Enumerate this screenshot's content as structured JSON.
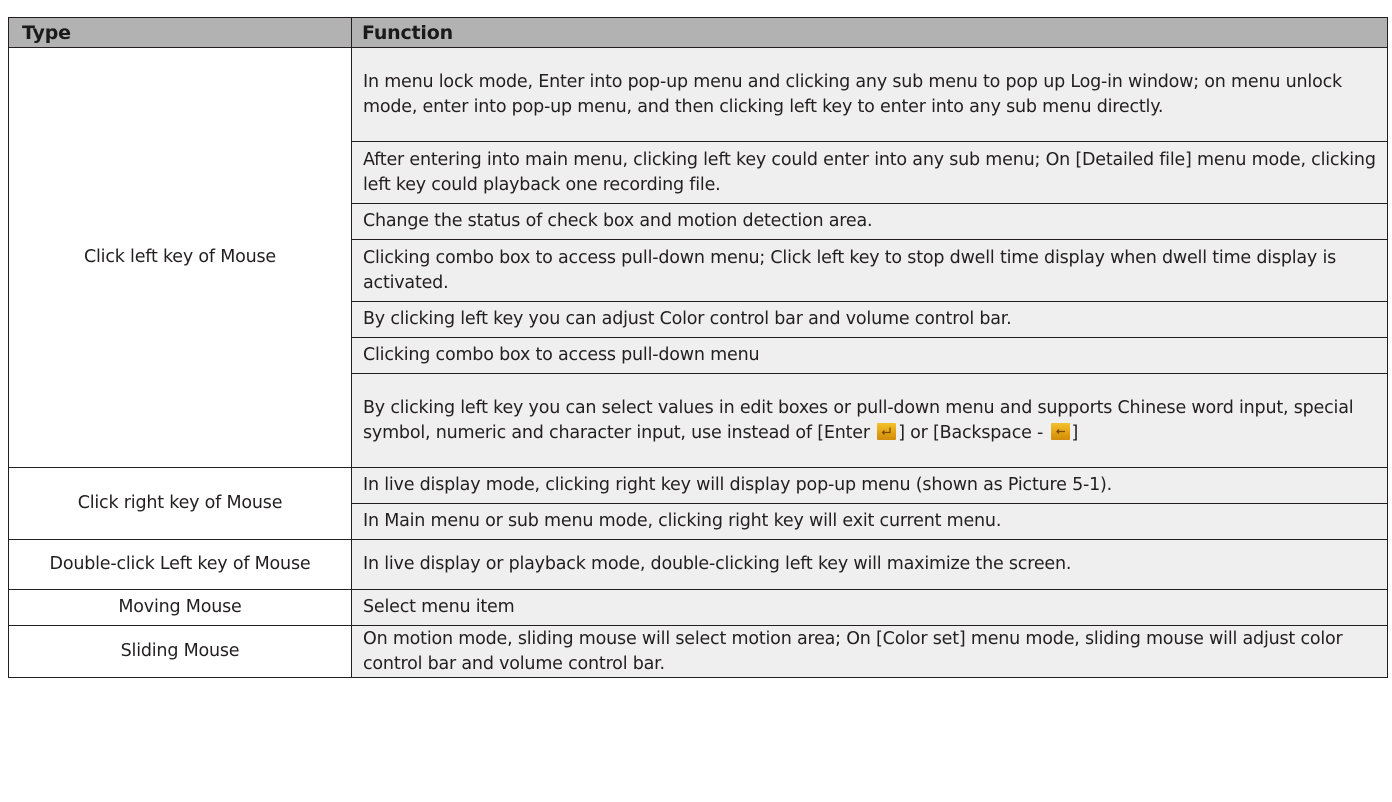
{
  "table": {
    "headers": {
      "type": "Type",
      "function": "Function"
    },
    "rows": [
      {
        "type": "Click left key of Mouse",
        "functions": [
          "In menu lock mode, Enter into pop-up menu and clicking any sub menu to pop up Log-in window; on menu unlock mode,  enter into pop-up menu, and then clicking left key to enter into any sub menu directly.",
          "After entering into main menu, clicking left key could enter into any sub menu; On [Detailed file] menu mode, clicking left key could playback one recording file.",
          "Change the status of check box and motion detection area.",
          "Clicking combo box to access pull-down menu; Click left key to stop dwell time display when dwell time display is activated.",
          "By clicking left key you can adjust Color control bar and volume control bar.",
          "Clicking combo box to access pull-down menu"
        ],
        "last_function": {
          "text_a": "By clicking left key you can select values in edit boxes or pull-down menu and supports Chinese word input, special symbol, numeric and character input, use instead of [Enter ",
          "text_b": "] or [Backspace - ",
          "text_c": "]",
          "enter_icon": "enter-key-icon",
          "backspace_icon": "backspace-key-icon"
        }
      },
      {
        "type": "Click right key of Mouse",
        "functions": [
          "In live display mode, clicking right key will display pop-up menu (shown as Picture 5-1).",
          "In Main menu or sub menu mode, clicking right key will exit current menu."
        ]
      },
      {
        "type": "Double-click Left key of Mouse",
        "functions": [
          "In live display or playback mode, double-clicking left key will maximize the screen."
        ]
      },
      {
        "type": "Moving Mouse",
        "functions": [
          "Select menu item"
        ]
      },
      {
        "type": "Sliding Mouse",
        "functions": [
          "On motion mode, sliding mouse will select motion area; On [Color set] menu mode, sliding mouse will adjust color control bar and volume control bar."
        ]
      }
    ]
  },
  "colors": {
    "header_bg": "#b2b2b2",
    "function_bg": "#efefef",
    "type_bg": "#ffffff",
    "icon_accent": "#e3a313"
  }
}
